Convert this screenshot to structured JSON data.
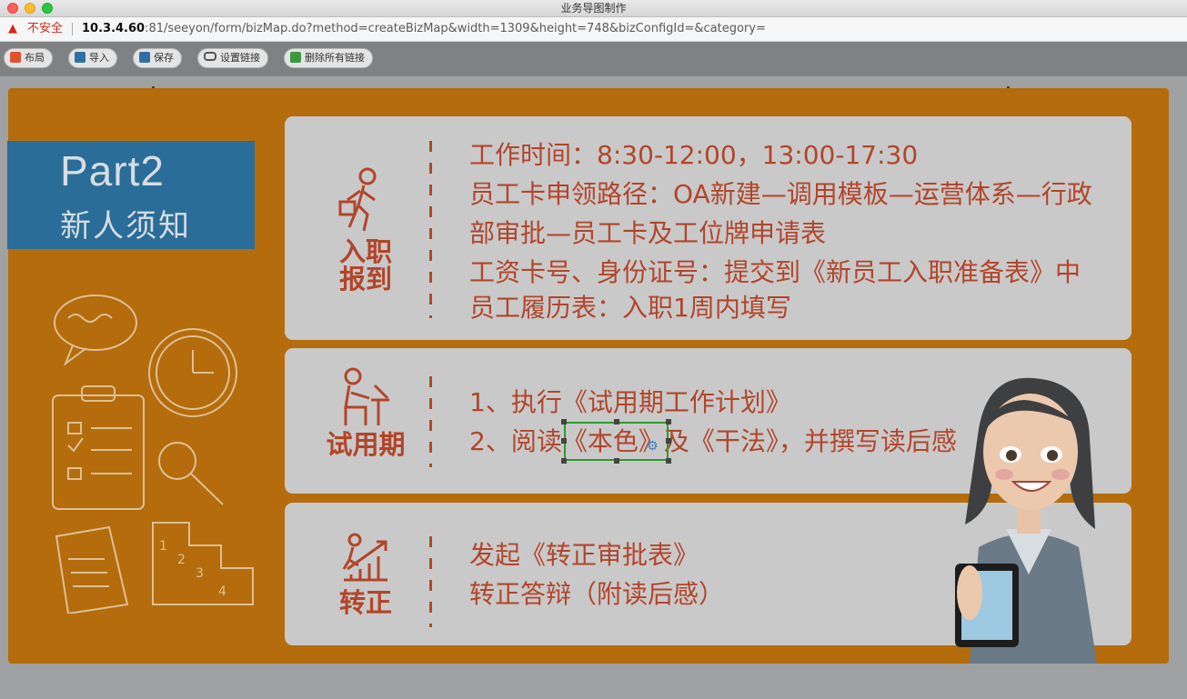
{
  "window": {
    "title": "业务导图制作"
  },
  "addressbar": {
    "warning_icon": "▲",
    "security_label": "不安全",
    "url_host": "10.3.4.60",
    "url_rest": ":81/seeyon/form/bizMap.do?method=createBizMap&width=1309&height=748&bizConfigId=&category="
  },
  "toolbar": {
    "buttons": [
      {
        "label": "布局",
        "icon": "layout-icon",
        "color": "#e0522c"
      },
      {
        "label": "导入",
        "icon": "import-icon",
        "color": "#2f6fa6"
      },
      {
        "label": "保存",
        "icon": "save-icon",
        "color": "#2f6fa6"
      },
      {
        "label": "设置链接",
        "icon": "link-icon",
        "color": "#555555"
      },
      {
        "label": "删除所有链接",
        "icon": "trash-icon",
        "color": "#3a9a3a"
      }
    ]
  },
  "slide": {
    "part_title": "Part2",
    "part_subtitle": "新人须知",
    "sections": [
      {
        "label_line1": "入职",
        "label_line2": "报到",
        "icon": "walking-person-icon",
        "lines": [
          "工作时间：8:30-12:00，13:00-17:30",
          "员工卡申领路径：OA新建—调用模板—运营体系—行政",
          "部审批—员工卡及工位牌申请表",
          "工资卡号、身份证号：提交到《新员工入职准备表》中",
          "员工履历表：入职1周内填写"
        ]
      },
      {
        "label_line1": "试用期",
        "icon": "person-at-desk-icon",
        "lines": [
          "1、执行《试用期工作计划》",
          "2、阅读《本色》及《干法》，并撰写读后感"
        ]
      },
      {
        "label_line1": "转正",
        "icon": "growth-chart-icon",
        "lines": [
          "发起《转正审批表》",
          "转正答辩（附读后感）"
        ]
      }
    ]
  },
  "colors": {
    "slide_bg": "#b46c0c",
    "panel_bg": "#c9c9c9",
    "text_red": "#b2452a",
    "part_box": "#2a6d98",
    "selection": "#2e9a2e"
  }
}
